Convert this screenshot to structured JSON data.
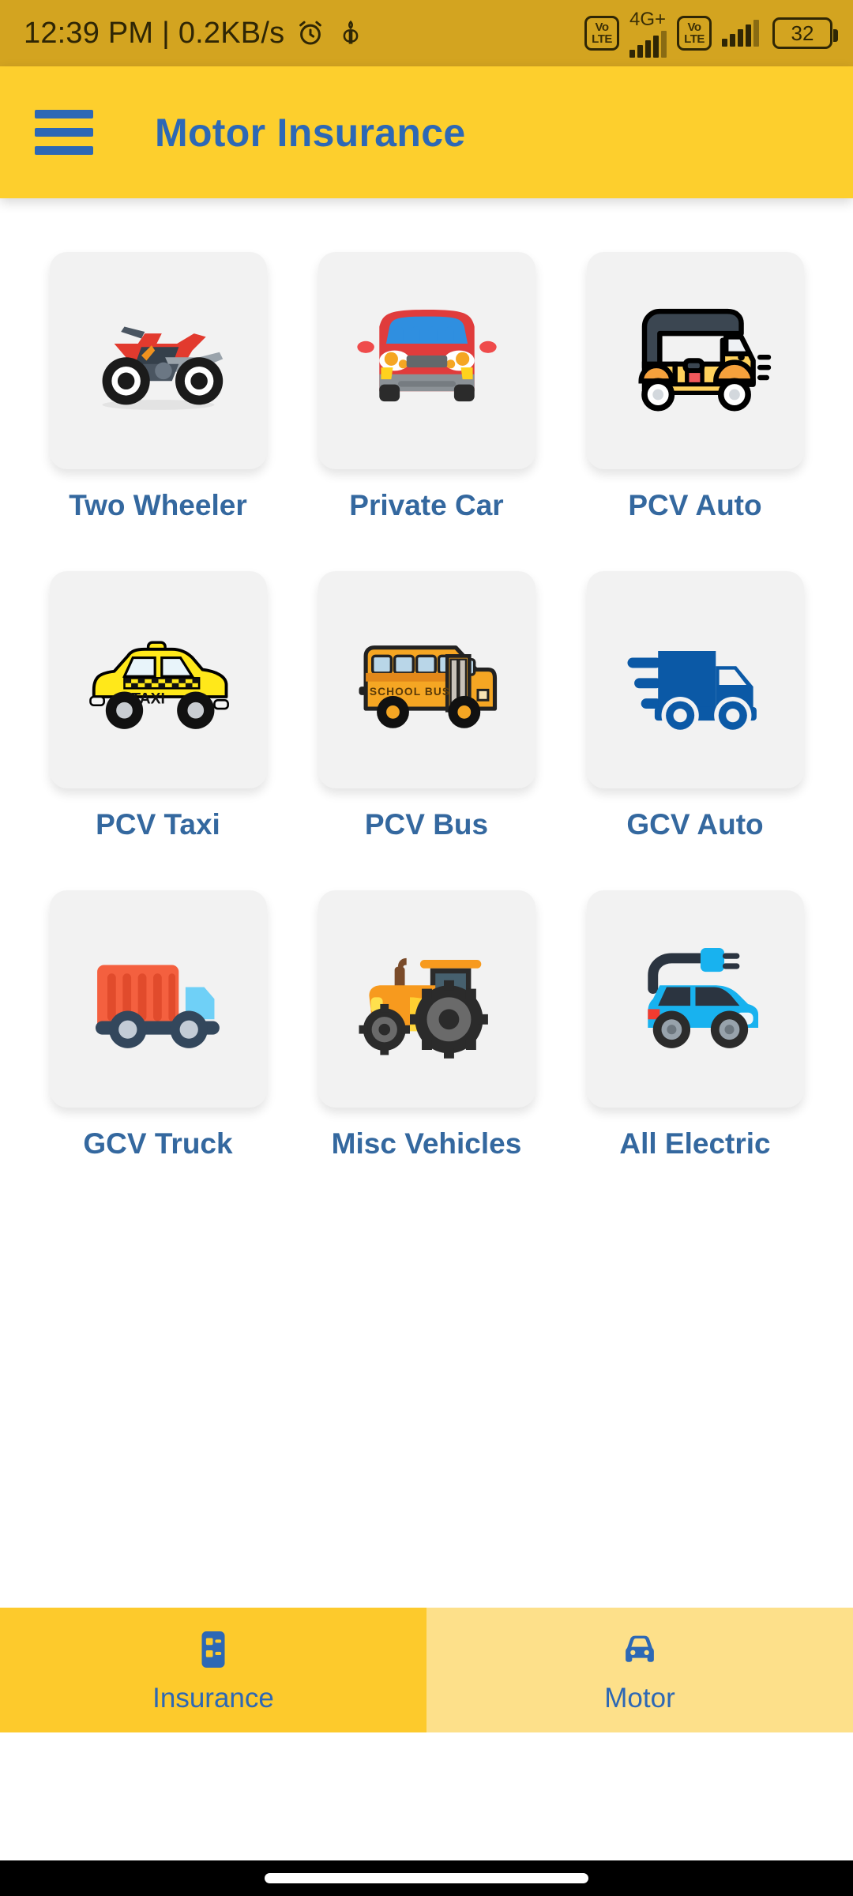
{
  "status_bar": {
    "time_and_network": "12:39 PM | 0.2KB/s",
    "alarm_icon": "alarm-clock-icon",
    "plant_icon": "leaf-plant-icon",
    "sim1_volte_top": "Vo",
    "sim1_volte_bottom": "LTE",
    "network_label": "4G+",
    "sim2_volte_top": "Vo",
    "sim2_volte_bottom": "LTE",
    "battery_level": "32",
    "background_color": "#d3a420"
  },
  "app_bar": {
    "menu_icon": "hamburger-menu-icon",
    "title": "Motor Insurance",
    "background_color": "#fdcf2d",
    "title_color": "#2d68b5"
  },
  "grid": {
    "items": [
      {
        "label": "Two Wheeler",
        "icon": "motorcycle-icon"
      },
      {
        "label": "Private Car",
        "icon": "car-front-icon"
      },
      {
        "label": "PCV Auto",
        "icon": "auto-rickshaw-icon"
      },
      {
        "label": "PCV Taxi",
        "icon": "taxi-icon"
      },
      {
        "label": "PCV Bus",
        "icon": "school-bus-icon"
      },
      {
        "label": "GCV Auto",
        "icon": "delivery-truck-icon"
      },
      {
        "label": "GCV Truck",
        "icon": "container-truck-icon"
      },
      {
        "label": "Misc Vehicles",
        "icon": "tractor-icon"
      },
      {
        "label": "All Electric",
        "icon": "electric-car-icon"
      }
    ],
    "card_background": "#f2f2f2",
    "label_color": "#34689f"
  },
  "bottom_nav": {
    "tabs": [
      {
        "label": "Insurance",
        "icon": "insurance-card-icon",
        "selected": true
      },
      {
        "label": "Motor",
        "icon": "car-front-nav-icon",
        "selected": false
      }
    ],
    "active_color": "#fdca2c",
    "inactive_color": "#fde08a",
    "label_color": "#2d68b5"
  },
  "icon_labels": {
    "taxi_sign": "TAXI",
    "bus_sign": "SCHOOL BUS"
  }
}
